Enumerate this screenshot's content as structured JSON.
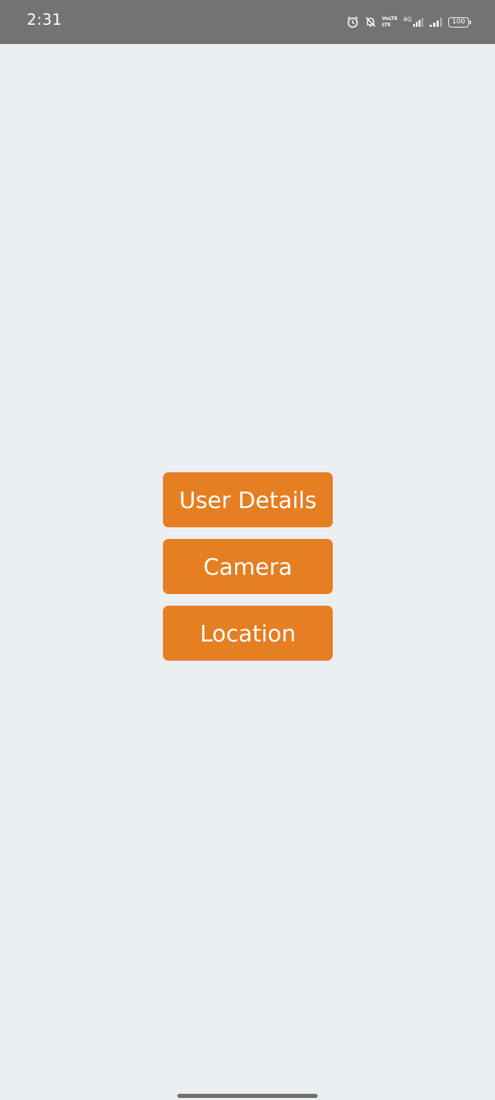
{
  "status_bar": {
    "time": "2:31",
    "network_label": "4G",
    "volte_label_top": "VoLTE",
    "volte_label_bottom": "LTE",
    "battery_level": "100",
    "icons": [
      "alarm-icon",
      "bell-off-icon",
      "volte-icon",
      "signal-4g-icon",
      "signal-icon",
      "battery-icon"
    ]
  },
  "main": {
    "buttons": [
      {
        "label": "User Details"
      },
      {
        "label": "Camera"
      },
      {
        "label": "Location"
      }
    ]
  },
  "colors": {
    "background": "#ebeff1",
    "status_bar": "#737373",
    "accent": "#e67e22",
    "button_text": "#ffffff"
  }
}
